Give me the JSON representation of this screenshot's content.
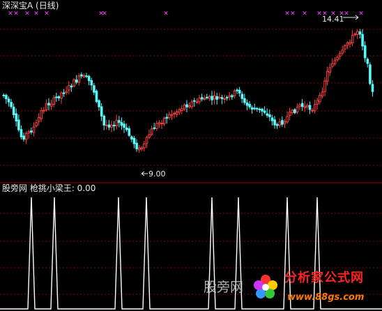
{
  "upper_panel": {
    "title": "深深宝A (日线)",
    "high_label": "14.41",
    "low_label": "9.00",
    "marker_glyph": "✕",
    "up_color": "#ff4040",
    "down_color": "#54fcfc",
    "marker_color": "#ff40ff",
    "grid_color": "#8b0000"
  },
  "lower_panel": {
    "title": "股旁网 枪挑小梁王: 0.00",
    "line_color": "#ffffff"
  },
  "watermark": {
    "text": "股旁网",
    "logo_text": "分析家公式网",
    "logo_url": "www.88gs.com"
  }
}
